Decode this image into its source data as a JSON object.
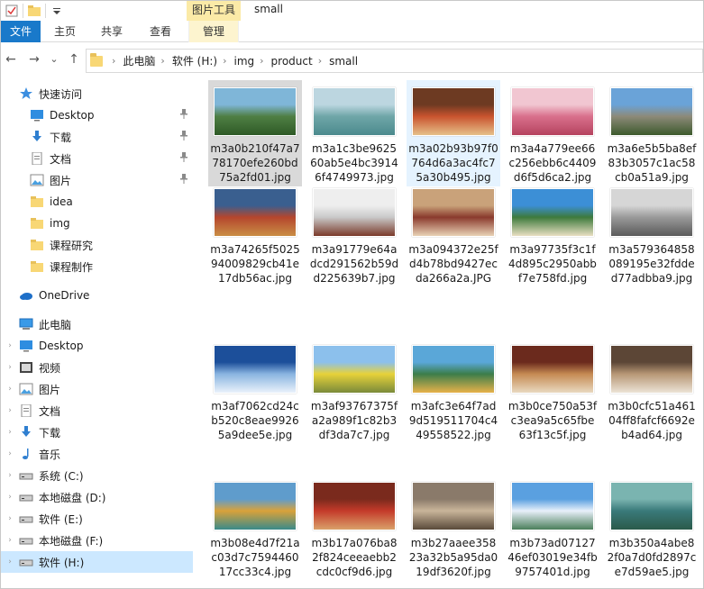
{
  "window": {
    "title": "small"
  },
  "quick_access_toolbar": {
    "icons": [
      "properties-icon",
      "new-folder-icon",
      "customize-dropdown-icon"
    ]
  },
  "ribbon": {
    "contextual_tab": "图片工具",
    "tabs": [
      "文件",
      "主页",
      "共享",
      "查看",
      "管理"
    ]
  },
  "address": {
    "crumbs": [
      "此电脑",
      "软件 (H:)",
      "img",
      "product",
      "small"
    ],
    "sep": "›"
  },
  "nav_buttons": {
    "back": "←",
    "forward": "→",
    "recent": "⌄",
    "up": "↑"
  },
  "navpane": {
    "items": [
      {
        "label": "快速访问",
        "icon": "star-icon",
        "expand": "",
        "pinned": false
      },
      {
        "label": "Desktop",
        "icon": "desktop-icon",
        "expand": "",
        "pinned": true
      },
      {
        "label": "下载",
        "icon": "download-icon",
        "expand": "",
        "pinned": true
      },
      {
        "label": "文档",
        "icon": "documents-icon",
        "expand": "",
        "pinned": true
      },
      {
        "label": "图片",
        "icon": "pictures-icon",
        "expand": "",
        "pinned": true
      },
      {
        "label": "idea",
        "icon": "folder-icon",
        "expand": "",
        "pinned": false
      },
      {
        "label": "img",
        "icon": "folder-icon",
        "expand": "",
        "pinned": false
      },
      {
        "label": "课程研究",
        "icon": "folder-icon",
        "expand": "",
        "pinned": false
      },
      {
        "label": "课程制作",
        "icon": "folder-icon",
        "expand": "",
        "pinned": false
      },
      {
        "label": "OneDrive",
        "icon": "onedrive-icon",
        "expand": "",
        "pinned": false
      },
      {
        "label": "此电脑",
        "icon": "computer-icon",
        "expand": "",
        "pinned": false
      },
      {
        "label": "Desktop",
        "icon": "desktop-icon",
        "expand": "›",
        "pinned": false
      },
      {
        "label": "视频",
        "icon": "videos-icon",
        "expand": "›",
        "pinned": false
      },
      {
        "label": "图片",
        "icon": "pictures-icon",
        "expand": "›",
        "pinned": false
      },
      {
        "label": "文档",
        "icon": "documents-icon",
        "expand": "›",
        "pinned": false
      },
      {
        "label": "下载",
        "icon": "download-icon",
        "expand": "›",
        "pinned": false
      },
      {
        "label": "音乐",
        "icon": "music-icon",
        "expand": "›",
        "pinned": false
      },
      {
        "label": "系统 (C:)",
        "icon": "drive-icon",
        "expand": "›",
        "pinned": false
      },
      {
        "label": "本地磁盘 (D:)",
        "icon": "drive-icon",
        "expand": "›",
        "pinned": false
      },
      {
        "label": "软件 (E:)",
        "icon": "drive-icon",
        "expand": "›",
        "pinned": false
      },
      {
        "label": "本地磁盘 (F:)",
        "icon": "drive-icon",
        "expand": "›",
        "pinned": false
      },
      {
        "label": "软件 (H:)",
        "icon": "drive-icon",
        "expand": "›",
        "pinned": false,
        "selected": true
      }
    ]
  },
  "files": [
    {
      "name": "m3a0b210f47a778170efe260bd75a2fd01.jpg",
      "colors": [
        "#7fb6d8",
        "#4f7f44",
        "#2e5a26"
      ],
      "state": "selected"
    },
    {
      "name": "m3a1c3be962560ab5e4bc39146f4749973.jpg",
      "colors": [
        "#bcd6e0",
        "#6fa6a8",
        "#4b8a8d"
      ],
      "state": ""
    },
    {
      "name": "m3a02b93b97f0764d6a3ac4fc75a30b495.jpg",
      "colors": [
        "#6d3a22",
        "#c9532e",
        "#e6c089"
      ],
      "state": "hover"
    },
    {
      "name": "m3a4a779ee66c256ebb6c4409d6f5d6ca2.jpg",
      "colors": [
        "#f1c6d1",
        "#d9708c",
        "#b5435f"
      ],
      "state": ""
    },
    {
      "name": "m3a6e5b5ba8ef83b3057c1ac58cb0a51a9.jpg",
      "colors": [
        "#6aa3d8",
        "#8d8a79",
        "#3d5a2d"
      ],
      "state": ""
    },
    {
      "name": "m3a74265f502594009829cb41e17db56ac.jpg",
      "colors": [
        "#3a5f8f",
        "#b5462d",
        "#c98e45"
      ],
      "state": ""
    },
    {
      "name": "m3a91779e64adcd291562b59dd225639b7.jpg",
      "colors": [
        "#eeeeee",
        "#c9c9c9",
        "#7a3a2a"
      ],
      "state": ""
    },
    {
      "name": "m3a094372e25fd4b78bd9427ecda266a2a.JPG",
      "colors": [
        "#c9a27a",
        "#8a3a2d",
        "#e8d2b5"
      ],
      "state": ""
    },
    {
      "name": "m3a97735f3c1f4d895c2950abbf7e758fd.jpg",
      "colors": [
        "#3c8fd6",
        "#3d7a3c",
        "#e9dfc2"
      ],
      "state": ""
    },
    {
      "name": "m3a579364858089195e32fdded77adbba9.jpg",
      "colors": [
        "#d6d6d6",
        "#9a9a9a",
        "#5a5a5a"
      ],
      "state": ""
    },
    {
      "name": "m3af7062cd24cb520c8eae99265a9dee5e.jpg",
      "colors": [
        "#1c4f9a",
        "#89b4e0",
        "#eaf2fb"
      ],
      "state": ""
    },
    {
      "name": "m3af93767375fa2a989f1c82b3df3da7c7.jpg",
      "colors": [
        "#8cc0ec",
        "#e7d23a",
        "#7a8a3a"
      ],
      "state": ""
    },
    {
      "name": "m3afc3e64f7ad9d519511704c449558522.jpg",
      "colors": [
        "#5aa7d8",
        "#3b7d4a",
        "#e7b24a"
      ],
      "state": ""
    },
    {
      "name": "m3b0ce750a53fc3ea9a5c65fbe63f13c5f.jpg",
      "colors": [
        "#6b2a1d",
        "#c58a52",
        "#e9d9c0"
      ],
      "state": ""
    },
    {
      "name": "m3b0cfc51a46104ff8fafcf6692eb4ad64.jpg",
      "colors": [
        "#5c4636",
        "#b79775",
        "#ece3d6"
      ],
      "state": ""
    },
    {
      "name": "m3b08e4d7f21ac03d7c759446017cc33c4.jpg",
      "colors": [
        "#5f9ccc",
        "#d9a23a",
        "#3a8a8a"
      ],
      "state": ""
    },
    {
      "name": "m3b17a076ba82f824ceeaebb2cdc0cf9d6.jpg",
      "colors": [
        "#7a2a1d",
        "#c43a2a",
        "#d9a06a"
      ],
      "state": ""
    },
    {
      "name": "m3b27aaee35823a32b5a95da019df3620f.jpg",
      "colors": [
        "#8a7a6a",
        "#c9b59a",
        "#5a4a3a"
      ],
      "state": ""
    },
    {
      "name": "m3b73ad0712746ef03019e34fb9757401d.jpg",
      "colors": [
        "#5aa0e0",
        "#e8f0fa",
        "#4a7f5a"
      ],
      "state": ""
    },
    {
      "name": "m3b350a4abe82f0a7d0fd2897ce7d59ae5.jpg",
      "colors": [
        "#7ab4b0",
        "#3a7a7a",
        "#2a5a4a"
      ],
      "state": ""
    }
  ]
}
